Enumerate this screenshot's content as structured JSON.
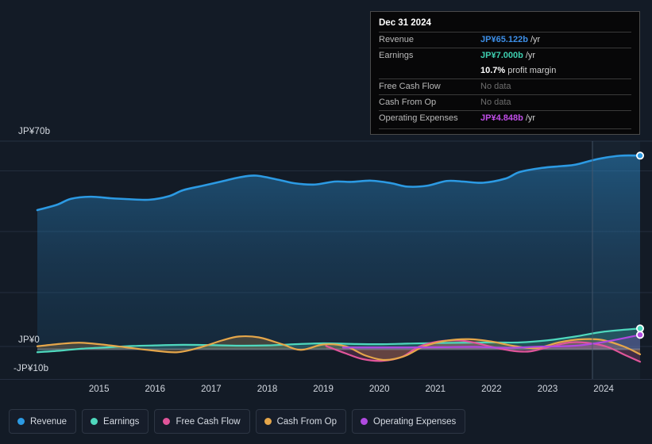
{
  "chart_data": {
    "type": "area",
    "title": "",
    "xlabel": "",
    "ylabel": "",
    "currency": "JP¥",
    "unit": "b",
    "grid": true,
    "legend_position": "bottom",
    "ylim": [
      -10,
      70
    ],
    "y_ticks": [
      {
        "label": "JP¥70b",
        "value": 70
      },
      {
        "label": "JP¥0",
        "value": 0
      },
      {
        "label": "-JP¥10b",
        "value": -10
      }
    ],
    "x_ticks": [
      "2015",
      "2016",
      "2017",
      "2018",
      "2019",
      "2020",
      "2021",
      "2022",
      "2023",
      "2024"
    ],
    "xlim": [
      "2014.4",
      "2025.2"
    ],
    "forecast_divider_x": "2024.3",
    "series": [
      {
        "name": "Revenue",
        "color": "#2c9ae3",
        "x": [
          2014.4,
          2014.75,
          2015.0,
          2015.35,
          2015.7,
          2016.0,
          2016.4,
          2016.75,
          2017.0,
          2017.35,
          2017.7,
          2018.0,
          2018.3,
          2018.7,
          2019.0,
          2019.35,
          2019.7,
          2020.0,
          2020.35,
          2020.7,
          2021.0,
          2021.35,
          2021.7,
          2022.0,
          2022.35,
          2022.75,
          2023.0,
          2023.4,
          2023.75,
          2024.0,
          2024.4,
          2024.8,
          2025.15
        ],
        "values": [
          46.8,
          48.6,
          50.6,
          51.3,
          50.8,
          50.5,
          50.3,
          51.5,
          53.5,
          55.0,
          56.5,
          57.8,
          58.4,
          57.0,
          55.8,
          55.4,
          56.4,
          56.3,
          56.7,
          55.9,
          54.7,
          55.0,
          56.6,
          56.4,
          56.0,
          57.4,
          59.6,
          61.0,
          61.6,
          62.1,
          64.0,
          65.1,
          65.122
        ]
      },
      {
        "name": "Earnings",
        "color": "#4fd8bd",
        "x": [
          2014.4,
          2014.8,
          2015.2,
          2015.7,
          2016.1,
          2016.5,
          2017.0,
          2017.5,
          2018.0,
          2018.5,
          2019.0,
          2019.5,
          2020.0,
          2020.5,
          2021.0,
          2021.5,
          2022.0,
          2022.5,
          2023.0,
          2023.5,
          2024.0,
          2024.5,
          2025.15
        ],
        "values": [
          -1.0,
          -0.5,
          0.2,
          0.7,
          1.1,
          1.3,
          1.5,
          1.4,
          1.2,
          1.3,
          1.7,
          2.0,
          1.8,
          1.7,
          1.9,
          2.1,
          2.2,
          2.3,
          2.3,
          3.0,
          4.3,
          5.9,
          7.0
        ]
      },
      {
        "name": "Free Cash Flow",
        "color": "#e0559a",
        "x": [
          2019.55,
          2019.9,
          2020.2,
          2020.55,
          2020.9,
          2021.2,
          2021.55,
          2021.9,
          2022.2,
          2022.55,
          2022.9,
          2023.2,
          2023.55,
          2023.9,
          2024.2,
          2024.55,
          2024.9,
          2025.15
        ],
        "values": [
          1.1,
          -1.4,
          -3.3,
          -3.9,
          -2.6,
          0.8,
          2.6,
          3.0,
          2.2,
          0.6,
          -0.6,
          -0.7,
          0.9,
          2.3,
          2.2,
          0.9,
          -2.1,
          -4.2
        ]
      },
      {
        "name": "Cash From Op",
        "color": "#e5a64a",
        "x": [
          2014.4,
          2014.8,
          2015.15,
          2015.55,
          2016.0,
          2016.45,
          2016.9,
          2017.3,
          2017.7,
          2018.0,
          2018.35,
          2018.75,
          2019.1,
          2019.5,
          2019.9,
          2020.25,
          2020.6,
          2020.95,
          2021.3,
          2021.7,
          2022.1,
          2022.5,
          2022.9,
          2023.3,
          2023.7,
          2024.05,
          2024.45,
          2024.85,
          2025.15
        ],
        "values": [
          1.0,
          1.8,
          2.2,
          1.6,
          0.6,
          -0.4,
          -1.0,
          0.6,
          3.0,
          4.3,
          4.0,
          1.8,
          -0.2,
          1.6,
          1.0,
          -2.1,
          -3.6,
          -2.3,
          1.0,
          2.9,
          3.4,
          2.6,
          1.1,
          0.4,
          2.3,
          3.3,
          3.2,
          1.0,
          -1.7
        ]
      },
      {
        "name": "Operating Expenses",
        "color": "#b04ae0",
        "x": [
          2019.85,
          2020.4,
          2021.0,
          2021.6,
          2022.2,
          2022.8,
          2023.4,
          2024.0,
          2024.55,
          2025.15
        ],
        "values": [
          0.6,
          0.6,
          0.6,
          0.7,
          0.8,
          0.5,
          0.9,
          1.2,
          2.6,
          4.848
        ]
      }
    ],
    "endpoints": [
      {
        "series": "Revenue",
        "color": "#2c9ae3",
        "value": 65.122
      },
      {
        "series": "Earnings",
        "color": "#4fd8bd",
        "value": 7.0
      },
      {
        "series": "Operating Expenses",
        "color": "#b04ae0",
        "value": 4.848
      }
    ]
  },
  "tooltip": {
    "title": "Dec 31 2024",
    "rows": [
      {
        "label": "Revenue",
        "value": "JP¥65.122b",
        "suffix": "/yr",
        "color": "#3d8fe8",
        "no_data": false
      },
      {
        "label": "Earnings",
        "value": "JP¥7.000b",
        "suffix": "/yr",
        "color": "#3ecfb0",
        "no_data": false
      },
      {
        "label": "",
        "value": "10.7%",
        "suffix": "profit margin",
        "color": "#ffffff",
        "no_data": false
      },
      {
        "label": "Free Cash Flow",
        "value": "No data",
        "suffix": "",
        "color": "#6e6e6e",
        "no_data": true
      },
      {
        "label": "Cash From Op",
        "value": "No data",
        "suffix": "",
        "color": "#6e6e6e",
        "no_data": true
      },
      {
        "label": "Operating Expenses",
        "value": "JP¥4.848b",
        "suffix": "/yr",
        "color": "#c04ee8",
        "no_data": false
      }
    ]
  },
  "legend": {
    "items": [
      {
        "label": "Revenue",
        "color": "#2c9ae3"
      },
      {
        "label": "Earnings",
        "color": "#4fd8bd"
      },
      {
        "label": "Free Cash Flow",
        "color": "#e0559a"
      },
      {
        "label": "Cash From Op",
        "color": "#e5a64a"
      },
      {
        "label": "Operating Expenses",
        "color": "#b04ae0"
      }
    ]
  },
  "colors": {
    "background": "#131b26",
    "grid": "#273243",
    "zero_line": "#8d93a0",
    "revenue": "#2c9ae3",
    "earnings": "#4fd8bd",
    "free_cash_flow": "#e0559a",
    "cash_from_op": "#e5a64a",
    "operating_expenses": "#b04ae0"
  }
}
